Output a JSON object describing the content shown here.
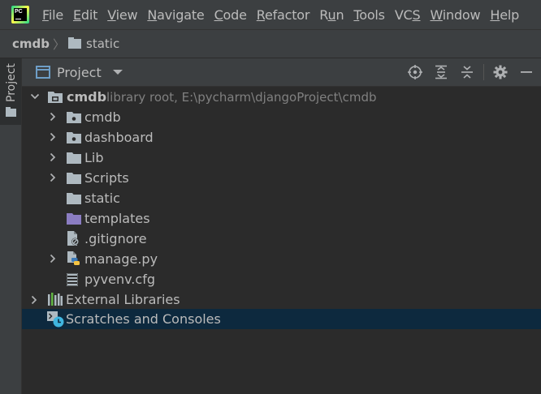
{
  "menu": {
    "logo_text": "PC",
    "items": [
      {
        "pre": "",
        "ul": "F",
        "post": "ile"
      },
      {
        "pre": "",
        "ul": "E",
        "post": "dit"
      },
      {
        "pre": "",
        "ul": "V",
        "post": "iew"
      },
      {
        "pre": "",
        "ul": "N",
        "post": "avigate"
      },
      {
        "pre": "",
        "ul": "C",
        "post": "ode"
      },
      {
        "pre": "",
        "ul": "R",
        "post": "efactor"
      },
      {
        "pre": "R",
        "ul": "u",
        "post": "n"
      },
      {
        "pre": "",
        "ul": "T",
        "post": "ools"
      },
      {
        "pre": "VC",
        "ul": "S",
        "post": ""
      },
      {
        "pre": "",
        "ul": "W",
        "post": "indow"
      },
      {
        "pre": "",
        "ul": "H",
        "post": "elp"
      }
    ]
  },
  "breadcrumb": {
    "root": "cmdb",
    "separator": "〉",
    "folder": "static"
  },
  "left_strip": {
    "tab_label": "Project"
  },
  "panel": {
    "title": "Project",
    "tools": [
      "locate-icon",
      "expand-all-icon",
      "collapse-all-icon",
      "gear-icon",
      "hide-icon"
    ]
  },
  "tree": {
    "root": {
      "name": "cmdb",
      "hint": "library root,  E:\\pycharm\\djangoProject\\cmdb"
    },
    "children": [
      {
        "name": "cmdb",
        "icon": "package-folder-icon",
        "expandable": true
      },
      {
        "name": "dashboard",
        "icon": "package-folder-icon",
        "expandable": true
      },
      {
        "name": "Lib",
        "icon": "folder-icon",
        "expandable": true
      },
      {
        "name": "Scripts",
        "icon": "folder-icon",
        "expandable": true
      },
      {
        "name": "static",
        "icon": "folder-icon",
        "expandable": false
      },
      {
        "name": "templates",
        "icon": "templates-folder-icon",
        "expandable": false
      },
      {
        "name": ".gitignore",
        "icon": "ignored-file-icon",
        "expandable": false
      },
      {
        "name": "manage.py",
        "icon": "python-file-icon",
        "expandable": true
      },
      {
        "name": "pyvenv.cfg",
        "icon": "config-file-icon",
        "expandable": false
      }
    ],
    "external_libraries": "External Libraries",
    "scratches": "Scratches and Consoles"
  },
  "colors": {
    "background": "#2b2b2b",
    "chrome": "#3c3f41",
    "selection": "#0d293e",
    "text": "#bbbbbb",
    "hint": "#808080",
    "folder": "#aeb9c0",
    "templates_folder": "#8b7dc2"
  }
}
